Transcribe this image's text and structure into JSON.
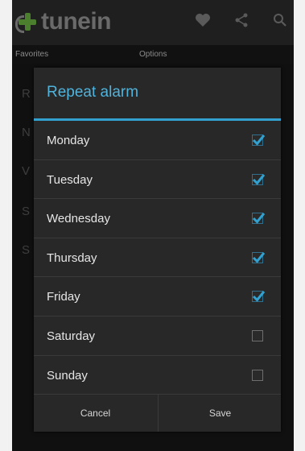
{
  "app": {
    "name": "tunein"
  },
  "tabs": [
    {
      "label": "Favorites"
    },
    {
      "label": "Options"
    }
  ],
  "background_letters": [
    "R",
    "N",
    "V",
    "S",
    "S"
  ],
  "dialog": {
    "title": "Repeat alarm",
    "days": [
      {
        "label": "Monday",
        "checked": true
      },
      {
        "label": "Tuesday",
        "checked": true
      },
      {
        "label": "Wednesday",
        "checked": true
      },
      {
        "label": "Thursday",
        "checked": true
      },
      {
        "label": "Friday",
        "checked": true
      },
      {
        "label": "Saturday",
        "checked": false
      },
      {
        "label": "Sunday",
        "checked": false
      }
    ],
    "cancel_label": "Cancel",
    "save_label": "Save"
  },
  "icons": {
    "favorite": "heart-icon",
    "share": "share-icon",
    "search": "search-icon"
  },
  "colors": {
    "accent": "#33a1d0",
    "title": "#4fb3dc",
    "logo_green": "#4c7f2d"
  }
}
